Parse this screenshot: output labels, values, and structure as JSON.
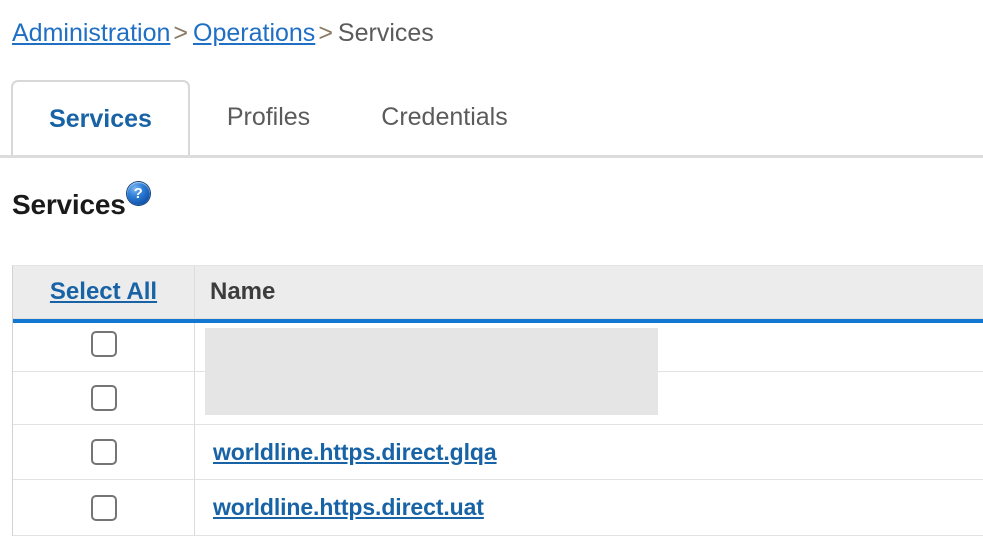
{
  "breadcrumb": {
    "items": [
      {
        "label": "Administration",
        "type": "link"
      },
      {
        "label": "Operations",
        "type": "link"
      },
      {
        "label": "Services",
        "type": "current"
      }
    ],
    "separator": ">"
  },
  "tabs": [
    {
      "label": "Services",
      "active": true
    },
    {
      "label": "Profiles",
      "active": false
    },
    {
      "label": "Credentials",
      "active": false
    }
  ],
  "page": {
    "title": "Services",
    "help_icon": "help-question-icon"
  },
  "table": {
    "columns": [
      {
        "key": "select",
        "label": "Select All",
        "is_link": true
      },
      {
        "key": "name",
        "label": "Name",
        "is_link": false
      }
    ],
    "accent_color": "#1177d1",
    "header_bg": "#ececec",
    "link_color": "#1763a6",
    "rows": [
      {
        "checked": false,
        "name": "",
        "redacted": true
      },
      {
        "checked": false,
        "name": "",
        "redacted": true
      },
      {
        "checked": false,
        "name": "worldline.https.direct.glqa",
        "redacted": false
      },
      {
        "checked": false,
        "name": "worldline.https.direct.uat",
        "redacted": false
      }
    ]
  }
}
